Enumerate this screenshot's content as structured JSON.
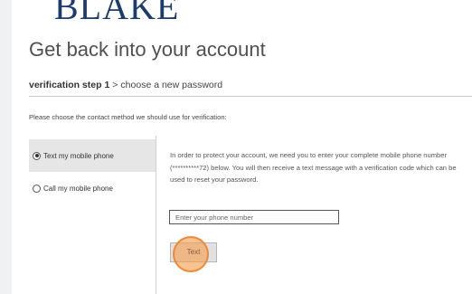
{
  "logo": {
    "text": "BLAKE"
  },
  "title": "Get back into your account",
  "steps": {
    "current": "verification step 1",
    "separator": ">",
    "next": "choose a new password"
  },
  "instruction": "Please choose the contact method we should use for verification:",
  "options": [
    {
      "label": "Text my mobile phone",
      "selected": true
    },
    {
      "label": "Call my mobile phone",
      "selected": false
    }
  ],
  "description": "In order to protect your account, we need you to enter your complete mobile phone number (**********72) below. You will then receive a text message with a verification code which can be used to reset your password.",
  "phone_input": {
    "placeholder": "Enter your phone number",
    "value": ""
  },
  "send_button": {
    "label": "Text"
  },
  "colors": {
    "logo": "#1d3c6b",
    "selected_option_bg": "#e6e6e6",
    "click_indicator": "#f49c4e"
  }
}
